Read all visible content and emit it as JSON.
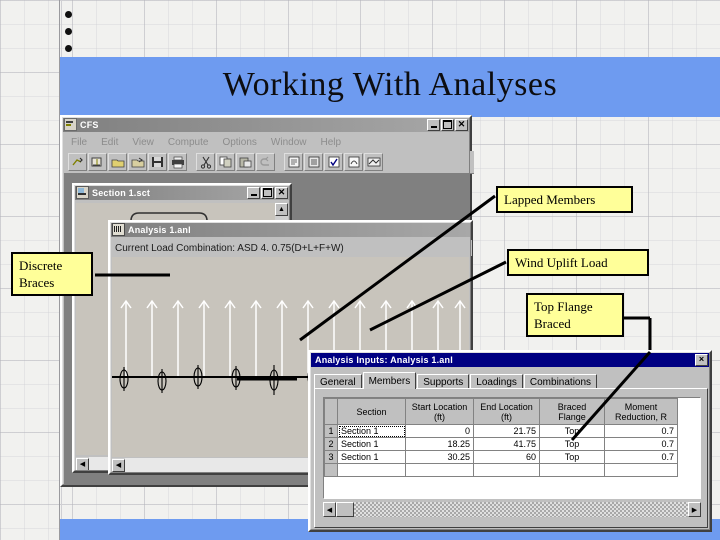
{
  "slide": {
    "title": "Working With Analyses",
    "bullets": [
      "",
      "",
      ""
    ],
    "banner_color": "#6e9bf0",
    "callout_fill": "#ffff99"
  },
  "callouts": [
    {
      "id": "discrete-braces",
      "lines": [
        "Discrete",
        "Braces"
      ]
    },
    {
      "id": "lapped-members",
      "lines": [
        "Lapped Members"
      ]
    },
    {
      "id": "wind-uplift-load",
      "lines": [
        "Wind Uplift Load"
      ]
    },
    {
      "id": "top-flange-braced",
      "lines": [
        "Top Flange",
        "Braced"
      ]
    }
  ],
  "cfs_window": {
    "title": "CFS",
    "menus": [
      "File",
      "Edit",
      "View",
      "Compute",
      "Options",
      "Window",
      "Help"
    ],
    "toolbar_icons": [
      "new-section-icon",
      "new-analysis-icon",
      "open-icon",
      "open-analysis-icon",
      "save-icon",
      "print-icon",
      "cut-icon",
      "copy-icon",
      "paste-icon",
      "undo-icon",
      "section-properties-icon",
      "analysis-inputs-icon",
      "check-icon",
      "report-icon",
      "diagram-icon"
    ],
    "sysbuttons": [
      "minimize",
      "maximize",
      "close"
    ]
  },
  "section_window": {
    "title": "Section 1.sct",
    "icon": "section-icon",
    "sysbuttons": [
      "minimize",
      "maximize",
      "close"
    ]
  },
  "analysis_window": {
    "title": "Analysis 1.anl",
    "icon": "analysis-icon",
    "load_combination": "Current Load Combination: ASD 4. 0.75(D+L+F+W)"
  },
  "inputs_dialog": {
    "title": "Analysis Inputs: Analysis 1.anl",
    "close_label": "×",
    "tabs": [
      {
        "label": "General",
        "active": false
      },
      {
        "label": "Members",
        "active": true
      },
      {
        "label": "Supports",
        "active": false
      },
      {
        "label": "Loadings",
        "active": false
      },
      {
        "label": "Combinations",
        "active": false
      }
    ],
    "grid": {
      "headers": [
        "Section",
        "Start Location\n(ft)",
        "End Location\n(ft)",
        "Braced\nFlange",
        "Moment\nReduction, R"
      ],
      "header_lines": [
        [
          "Section",
          ""
        ],
        [
          "Start Location",
          "(ft)"
        ],
        [
          "End Location",
          "(ft)"
        ],
        [
          "Braced",
          "Flange"
        ],
        [
          "Moment",
          "Reduction, R"
        ]
      ],
      "rows": [
        {
          "num": "1",
          "section": "Section 1",
          "start": "0",
          "end": "21.75",
          "flange": "Top",
          "r": "0.7",
          "selected": true
        },
        {
          "num": "2",
          "section": "Section 1",
          "start": "18.25",
          "end": "41.75",
          "flange": "Top",
          "r": "0.7",
          "selected": false
        },
        {
          "num": "3",
          "section": "Section 1",
          "start": "30.25",
          "end": "60",
          "flange": "Top",
          "r": "0.7",
          "selected": false
        }
      ]
    }
  }
}
